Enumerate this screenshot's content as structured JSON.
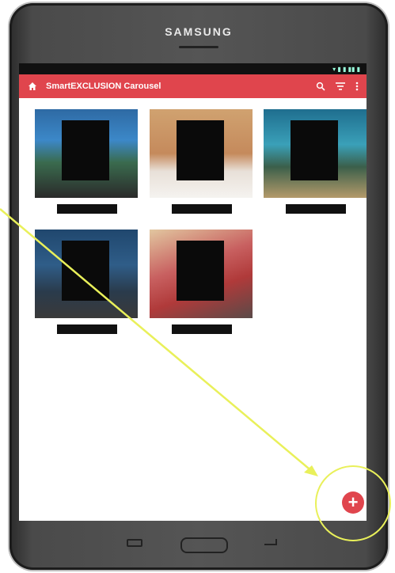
{
  "device": {
    "brand": "SAMSUNG"
  },
  "app": {
    "title": "SmartEXCLUSION Carousel"
  },
  "icons": {
    "home": "home-icon",
    "search": "search-icon",
    "filter": "filter-icon",
    "overflow": "overflow-menu-icon",
    "add": "plus-icon"
  },
  "colors": {
    "accent": "#e0454d",
    "annotation": "#e9f05a"
  },
  "gallery": {
    "count": 5
  }
}
